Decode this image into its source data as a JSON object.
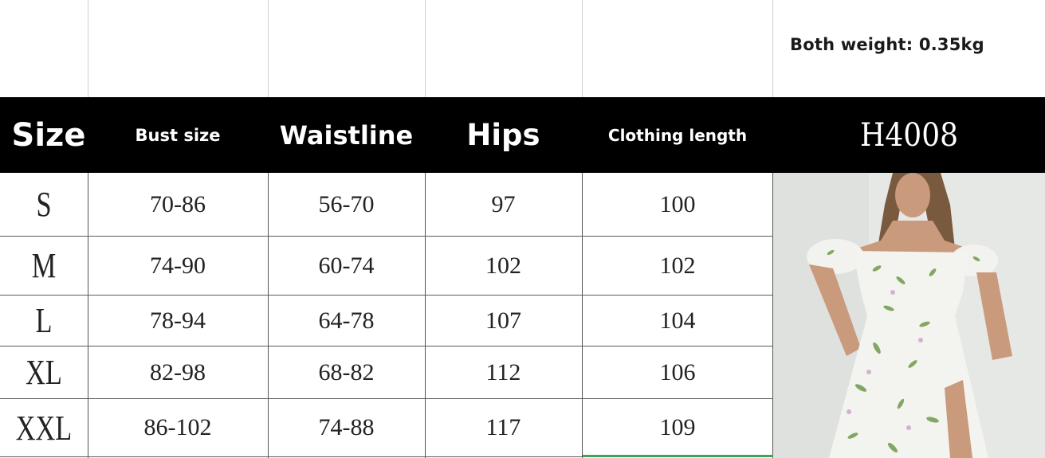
{
  "weight_note": "Both weight: 0.35kg",
  "header": {
    "size": "Size",
    "bust": "Bust size",
    "waist": "Waistline",
    "hips": "Hips",
    "length": "Clothing length",
    "code": "H4008"
  },
  "rows": [
    {
      "size": "S",
      "bust": "70-86",
      "waist": "56-70",
      "hips": "97",
      "length": "100"
    },
    {
      "size": "M",
      "bust": "74-90",
      "waist": "60-74",
      "hips": "102",
      "length": "102"
    },
    {
      "size": "L",
      "bust": "78-94",
      "waist": "64-78",
      "hips": "107",
      "length": "104"
    },
    {
      "size": "XL",
      "bust": "82-98",
      "waist": "68-82",
      "hips": "112",
      "length": "106"
    },
    {
      "size": "XXL",
      "bust": "86-102",
      "waist": "74-88",
      "hips": "117",
      "length": "109"
    }
  ],
  "colors": {
    "header_bg": "#000000",
    "header_text": "#ffffff",
    "dress_leaf": "#6f9a4a",
    "accent_line": "#3aa65a"
  }
}
